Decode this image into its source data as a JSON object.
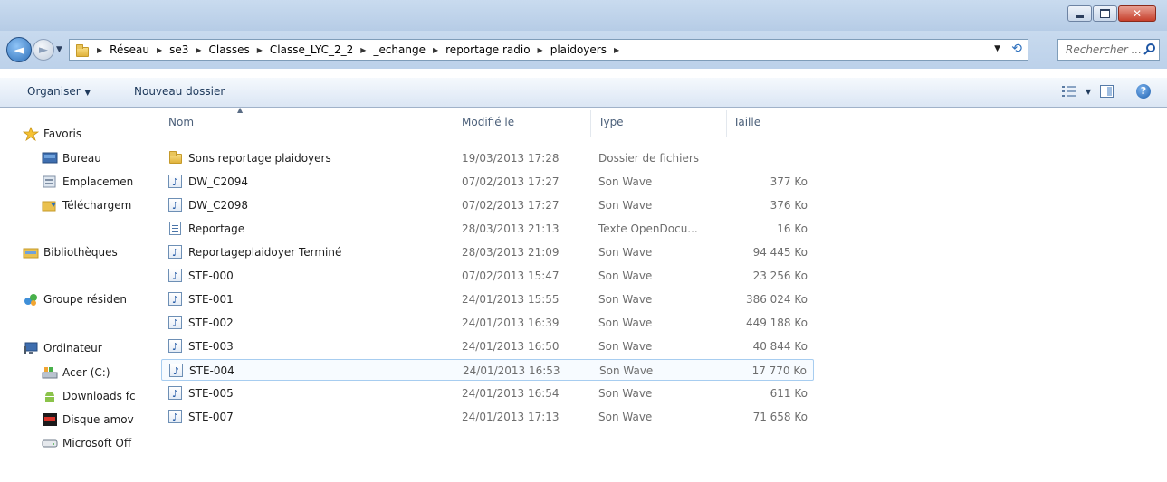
{
  "window": {
    "controls": [
      "minimize-icon",
      "restore-icon",
      "close-icon"
    ]
  },
  "address": {
    "crumbs": [
      "Réseau",
      "se3",
      "Classes",
      "Classe_LYC_2_2",
      "_echange",
      "reportage radio",
      "plaidoyers"
    ],
    "search_placeholder": "Rechercher ..."
  },
  "toolbar": {
    "organize": "Organiser",
    "new_folder": "Nouveau dossier"
  },
  "nav": {
    "favorites": "Favoris",
    "desktop": "Bureau",
    "recent": "Emplacemen",
    "downloads": "Téléchargem",
    "libraries": "Bibliothèques",
    "homegroup": "Groupe résiden",
    "computer": "Ordinateur",
    "drive_c": "Acer (C:)",
    "downloads_fc": "Downloads fc",
    "removable": "Disque amov",
    "office": "Microsoft Off"
  },
  "columns": {
    "name": "Nom",
    "modified": "Modifié le",
    "type": "Type",
    "size": "Taille"
  },
  "files": [
    {
      "name": "Sons  reportage plaidoyers",
      "date": "19/03/2013 17:28",
      "type": "Dossier de fichiers",
      "size": "",
      "icon": "folder-icon"
    },
    {
      "name": "DW_C2094",
      "date": "07/02/2013 17:27",
      "type": "Son Wave",
      "size": "377 Ko",
      "icon": "wave-file-icon"
    },
    {
      "name": "DW_C2098",
      "date": "07/02/2013 17:27",
      "type": "Son Wave",
      "size": "376 Ko",
      "icon": "wave-file-icon"
    },
    {
      "name": "Reportage",
      "date": "28/03/2013 21:13",
      "type": "Texte OpenDocu...",
      "size": "16 Ko",
      "icon": "document-icon"
    },
    {
      "name": "Reportageplaidoyer Terminé",
      "date": "28/03/2013 21:09",
      "type": "Son Wave",
      "size": "94 445 Ko",
      "icon": "wave-file-icon"
    },
    {
      "name": "STE-000",
      "date": "07/02/2013 15:47",
      "type": "Son Wave",
      "size": "23 256 Ko",
      "icon": "wave-file-icon"
    },
    {
      "name": "STE-001",
      "date": "24/01/2013 15:55",
      "type": "Son Wave",
      "size": "386 024 Ko",
      "icon": "wave-file-icon"
    },
    {
      "name": "STE-002",
      "date": "24/01/2013 16:39",
      "type": "Son Wave",
      "size": "449 188 Ko",
      "icon": "wave-file-icon"
    },
    {
      "name": "STE-003",
      "date": "24/01/2013 16:50",
      "type": "Son Wave",
      "size": "40 844 Ko",
      "icon": "wave-file-icon"
    },
    {
      "name": "STE-004",
      "date": "24/01/2013 16:53",
      "type": "Son Wave",
      "size": "17 770 Ko",
      "icon": "wave-file-icon"
    },
    {
      "name": "STE-005",
      "date": "24/01/2013 16:54",
      "type": "Son Wave",
      "size": "611 Ko",
      "icon": "wave-file-icon"
    },
    {
      "name": "STE-007",
      "date": "24/01/2013 17:13",
      "type": "Son Wave",
      "size": "71 658 Ko",
      "icon": "wave-file-icon"
    }
  ]
}
